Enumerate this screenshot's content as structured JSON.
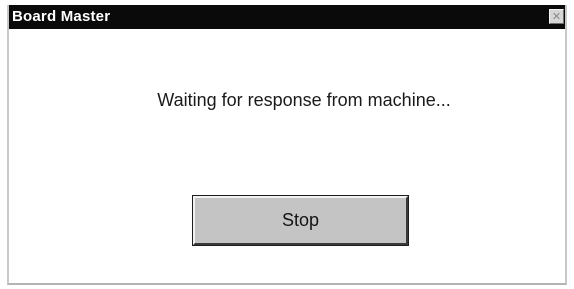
{
  "window": {
    "title": "Board Master",
    "close_glyph": "✕"
  },
  "dialog": {
    "message": "Waiting for response from machine...",
    "stop_label": "Stop"
  }
}
